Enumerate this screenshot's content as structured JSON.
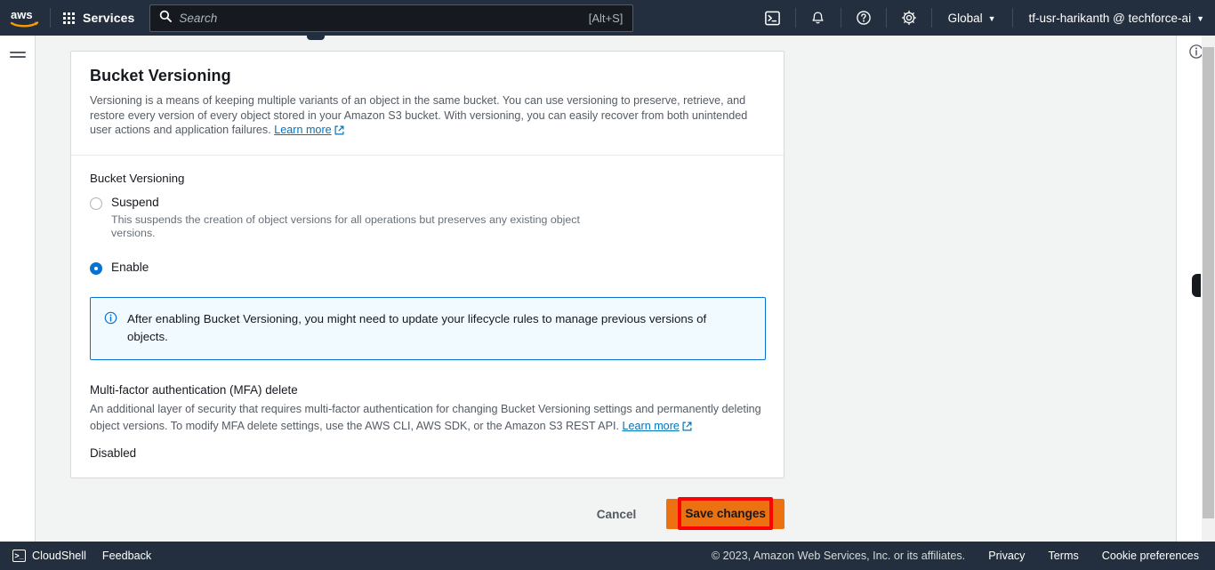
{
  "topnav": {
    "logo_alt": "aws",
    "services_label": "Services",
    "search_placeholder": "Search",
    "search_value": "",
    "search_shortcut": "[Alt+S]",
    "cloudshell_icon": "cloudshell-icon",
    "notifications_icon": "bell-icon",
    "help_icon": "question-mark-icon",
    "settings_icon": "gear-icon",
    "region_label": "Global",
    "account_label": "tf-usr-harikanth @ techforce-ai",
    "caret": "▼"
  },
  "left_rail": {
    "menu_icon": "hamburger-menu-icon"
  },
  "right_rail": {
    "info_icon": "info-circle-icon"
  },
  "card": {
    "title": "Bucket Versioning",
    "description_part1": "Versioning is a means of keeping multiple variants of an object in the same bucket. You can use versioning to preserve, retrieve, and restore every version of every object stored in your Amazon S3 bucket. With versioning, you can easily recover from both unintended user actions and application failures. ",
    "learn_more": "Learn more",
    "external_icon": "external-link-icon"
  },
  "versioning": {
    "field_label": "Bucket Versioning",
    "options": [
      {
        "label": "Suspend",
        "hint": "This suspends the creation of object versions for all operations but preserves any existing object versions.",
        "selected": false
      },
      {
        "label": "Enable",
        "hint": "",
        "selected": true
      }
    ]
  },
  "alert": {
    "icon": "info-circle-icon",
    "text": "After enabling Bucket Versioning, you might need to update your lifecycle rules to manage previous versions of objects.",
    "accent_color": "#0972d3",
    "background_color": "#f1faff"
  },
  "mfa": {
    "title": "Multi-factor authentication (MFA) delete",
    "description": "An additional layer of security that requires multi-factor authentication for changing Bucket Versioning settings and permanently deleting object versions. To modify MFA delete settings, use the AWS CLI, AWS SDK, or the Amazon S3 REST API. ",
    "learn_more": "Learn more",
    "external_icon": "external-link-icon",
    "value": "Disabled"
  },
  "actions": {
    "cancel_label": "Cancel",
    "save_label": "Save changes",
    "save_color": "#ec7211",
    "highlight_color": "#ff0000"
  },
  "footer": {
    "cloudshell_label": "CloudShell",
    "feedback_label": "Feedback",
    "copyright": "© 2023, Amazon Web Services, Inc. or its affiliates.",
    "privacy_label": "Privacy",
    "terms_label": "Terms",
    "cookie_label": "Cookie preferences"
  }
}
